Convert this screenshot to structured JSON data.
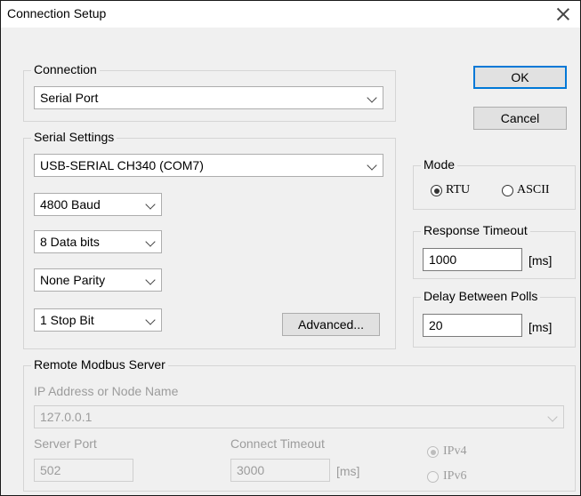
{
  "window": {
    "title": "Connection Setup"
  },
  "buttons": {
    "ok": "OK",
    "cancel": "Cancel",
    "advanced": "Advanced..."
  },
  "connection": {
    "group_label": "Connection",
    "selected": "Serial Port"
  },
  "serial": {
    "group_label": "Serial Settings",
    "port": "USB-SERIAL CH340 (COM7)",
    "baud": "4800 Baud",
    "data_bits": "8 Data bits",
    "parity": "None Parity",
    "stop_bits": "1 Stop Bit"
  },
  "mode": {
    "group_label": "Mode",
    "rtu": "RTU",
    "ascii": "ASCII",
    "selected": "RTU"
  },
  "response_timeout": {
    "group_label": "Response Timeout",
    "value": "1000",
    "unit": "[ms]"
  },
  "delay_polls": {
    "group_label": "Delay Between Polls",
    "value": "20",
    "unit": "[ms]"
  },
  "remote": {
    "group_label": "Remote Modbus Server",
    "ip_label": "IP Address or Node Name",
    "ip_value": "127.0.0.1",
    "port_label": "Server Port",
    "port_value": "502",
    "timeout_label": "Connect Timeout",
    "timeout_value": "3000",
    "timeout_unit": "[ms]",
    "ipv4": "IPv4",
    "ipv6": "IPv6",
    "selected_ip_version": "IPv4"
  }
}
